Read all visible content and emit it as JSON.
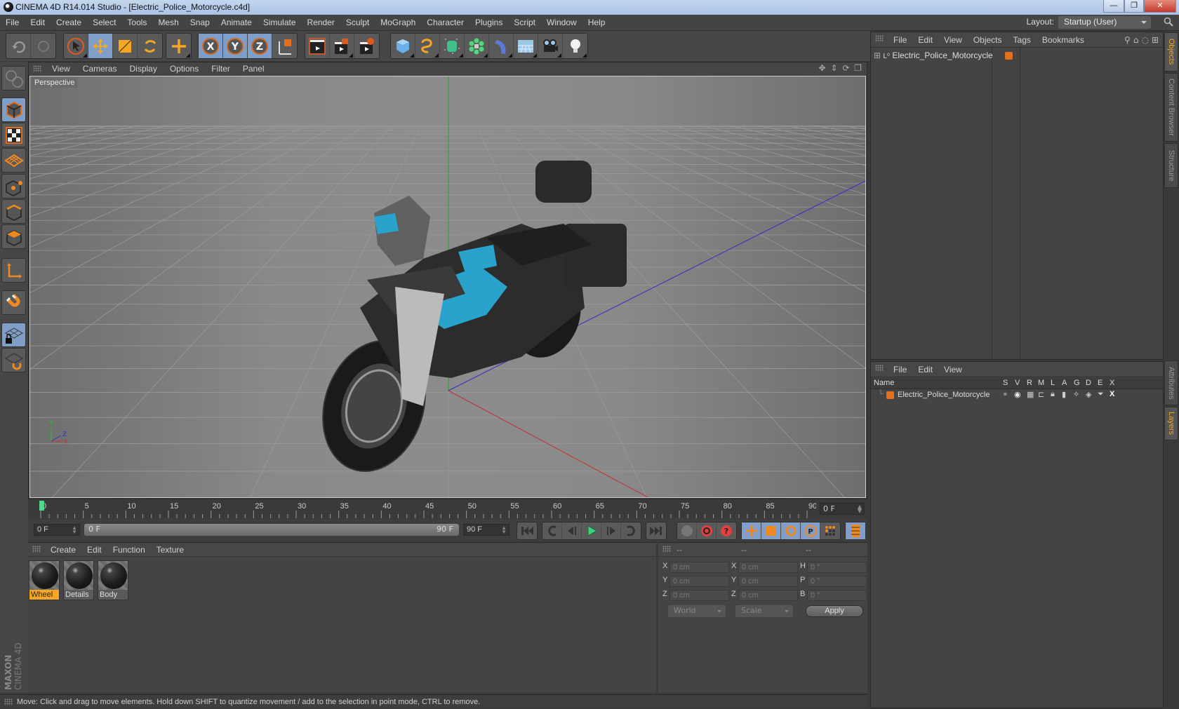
{
  "window": {
    "title": "CINEMA 4D R14.014 Studio - [Electric_Police_Motorcycle.c4d]",
    "controls": {
      "minimize": "—",
      "restore": "❐",
      "close": "✕"
    }
  },
  "menubar": {
    "items": [
      "File",
      "Edit",
      "Create",
      "Select",
      "Tools",
      "Mesh",
      "Snap",
      "Animate",
      "Simulate",
      "Render",
      "Sculpt",
      "MoGraph",
      "Character",
      "Plugins",
      "Script",
      "Window",
      "Help"
    ],
    "layout_label": "Layout:",
    "layout_value": "Startup (User)"
  },
  "toolbar": {
    "groups": [
      [
        "undo-icon",
        "redo-icon"
      ],
      [
        "live-selection-icon",
        "move-icon",
        "scale-icon",
        "rotate-icon"
      ],
      [
        "recent-tool-icon"
      ],
      [
        "x-axis-icon",
        "y-axis-icon",
        "z-axis-icon",
        "coordinate-system-icon"
      ],
      [
        "render-view-icon",
        "render-picture-viewer-icon",
        "render-settings-icon"
      ],
      [
        "cube-icon",
        "spline-pen-icon",
        "subdivision-surface-icon",
        "cloner-icon",
        "deformer-bend-icon",
        "floor-icon",
        "camera-icon",
        "light-icon"
      ]
    ],
    "active": [
      "move-icon",
      "x-axis-icon",
      "y-axis-icon",
      "z-axis-icon"
    ]
  },
  "left_tools": [
    "make-editable-icon",
    "model-mode-icon",
    "texture-mode-icon",
    "workplane-mode-icon",
    "points-mode-icon",
    "edges-mode-icon",
    "polygons-mode-icon",
    "axis-mode-icon",
    "snap-magnet-icon",
    "workplane-lock-icon",
    "workplane-rotate-icon"
  ],
  "brand": {
    "line1": "MAXON",
    "line2": "CINEMA 4D"
  },
  "viewport": {
    "menu": [
      "View",
      "Cameras",
      "Display",
      "Options",
      "Filter",
      "Panel"
    ],
    "camera_label": "Perspective",
    "nav_icons": [
      "pan-icon",
      "zoom-icon",
      "orbit-icon",
      "maximize-icon"
    ],
    "axis_labels": {
      "x": "X",
      "y": "Y",
      "z": "Z"
    }
  },
  "timeline": {
    "ticks": [
      0,
      5,
      10,
      15,
      20,
      25,
      30,
      35,
      40,
      45,
      50,
      55,
      60,
      65,
      70,
      75,
      80,
      85,
      90
    ],
    "max": 90,
    "current_frame": "0 F"
  },
  "playback": {
    "start_field": "0 F",
    "range_start": "0 F",
    "range_end": "90 F",
    "end_field": "90 F"
  },
  "materials": {
    "menu": [
      "Create",
      "Edit",
      "Function",
      "Texture"
    ],
    "items": [
      {
        "name": "Wheel",
        "selected": true
      },
      {
        "name": "Details",
        "selected": false
      },
      {
        "name": "Body",
        "selected": false
      }
    ]
  },
  "coordinates": {
    "headers": [
      "--",
      "--",
      "--"
    ],
    "rows": [
      {
        "l1": "X",
        "v1": "0 cm",
        "l2": "X",
        "v2": "0 cm",
        "l3": "H",
        "v3": "0 °"
      },
      {
        "l1": "Y",
        "v1": "0 cm",
        "l2": "Y",
        "v2": "0 cm",
        "l3": "P",
        "v3": "0 °"
      },
      {
        "l1": "Z",
        "v1": "0 cm",
        "l2": "Z",
        "v2": "0 cm",
        "l3": "B",
        "v3": "0 °"
      }
    ],
    "space_dropdown": "World",
    "mode_dropdown": "Scale",
    "apply_label": "Apply"
  },
  "status": "Move: Click and drag to move elements. Hold down SHIFT to quantize movement / add to the selection in point mode, CTRL to remove.",
  "objects_panel": {
    "menu": [
      "File",
      "Edit",
      "View",
      "Objects",
      "Tags",
      "Bookmarks"
    ],
    "items": [
      {
        "name": "Electric_Police_Motorcycle",
        "color": "#e07020"
      }
    ]
  },
  "layers_panel": {
    "menu": [
      "File",
      "Edit",
      "View"
    ],
    "columns": [
      "Name",
      "S",
      "V",
      "R",
      "M",
      "L",
      "A",
      "G",
      "D",
      "E",
      "X"
    ],
    "rows": [
      {
        "name": "Electric_Police_Motorcycle",
        "color": "#e07020"
      }
    ]
  },
  "side_tabs": {
    "top": [
      {
        "label": "Objects",
        "active": true
      },
      {
        "label": "Content Browser",
        "active": false
      },
      {
        "label": "Structure",
        "active": false
      }
    ],
    "bottom": [
      {
        "label": "Attributes",
        "active": false
      },
      {
        "label": "Layers",
        "active": true
      }
    ]
  },
  "colors": {
    "accent": "#f5a623",
    "active_button": "#7f9ec9",
    "object_tag": "#e07020"
  }
}
